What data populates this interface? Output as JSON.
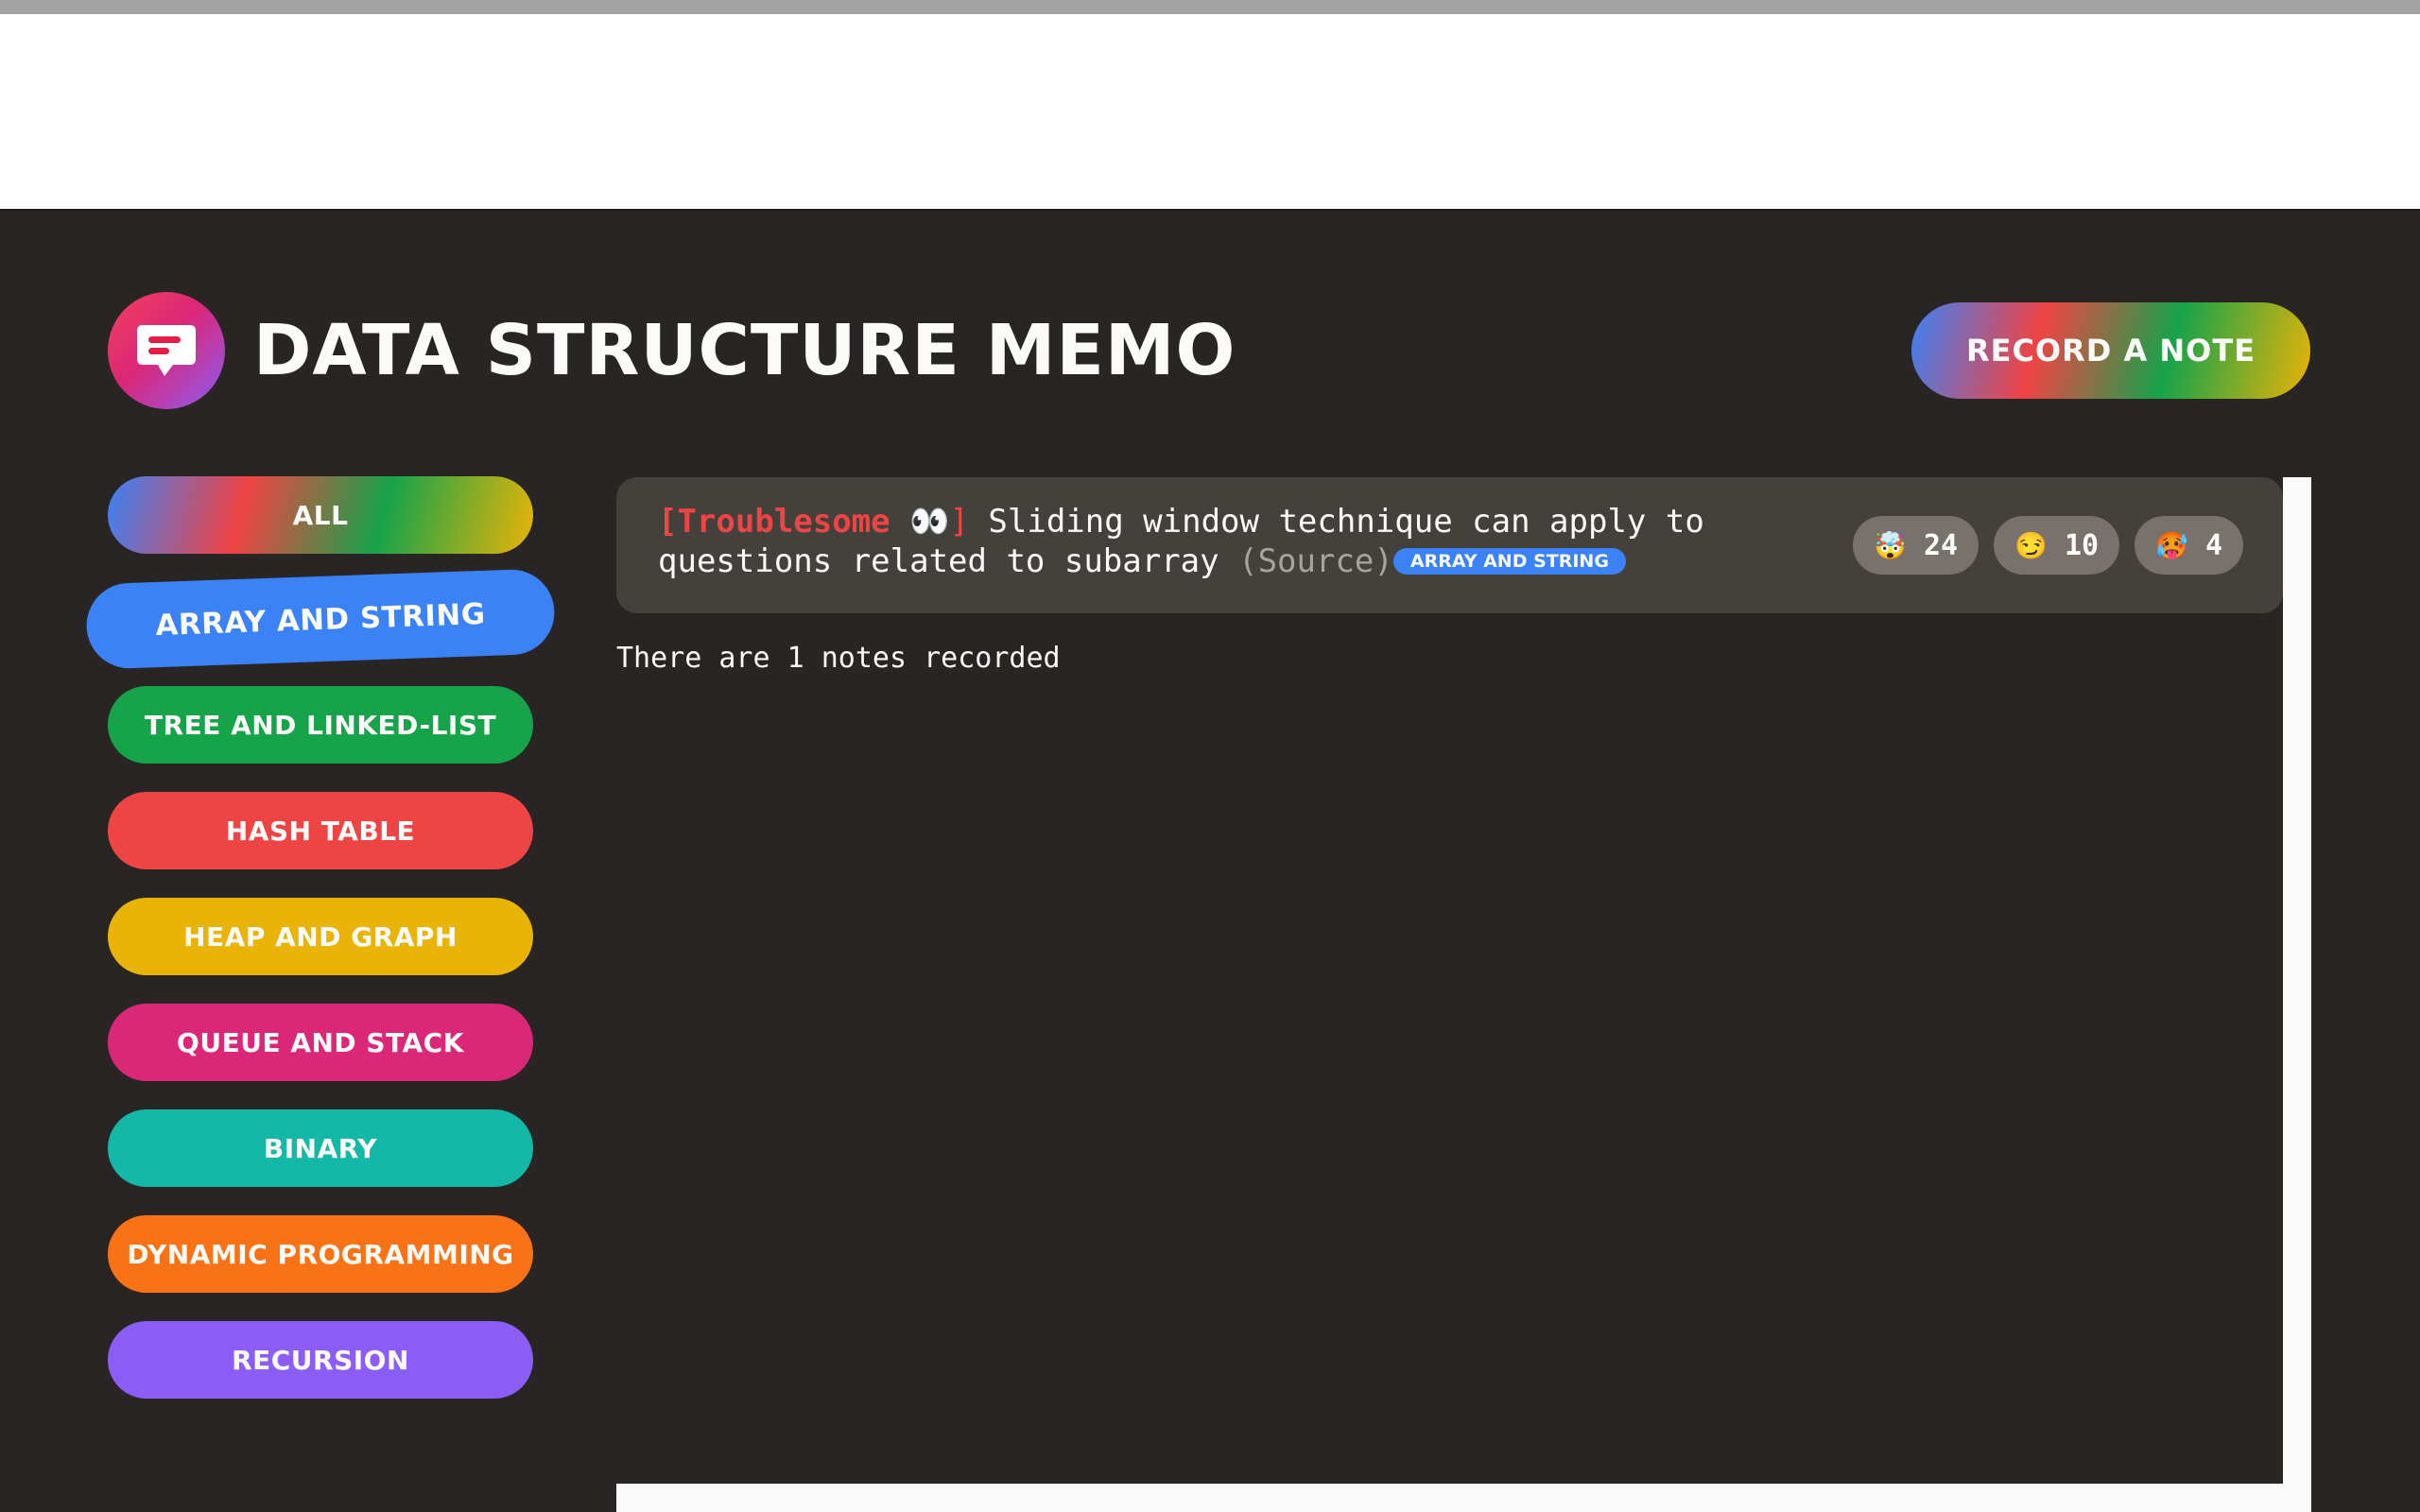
{
  "header": {
    "title": "DATA STRUCTURE MEMO",
    "record_button": "RECORD A NOTE",
    "logo_icon": "chat-bubble-icon"
  },
  "sidebar": {
    "categories": [
      {
        "label": "ALL",
        "color": "gradient"
      },
      {
        "label": "ARRAY AND STRING",
        "color": "#3b82f6",
        "selected": true
      },
      {
        "label": "TREE AND LINKED-LIST",
        "color": "#16a34a"
      },
      {
        "label": "HASH TABLE",
        "color": "#ef4444"
      },
      {
        "label": "HEAP AND GRAPH",
        "color": "#eab308"
      },
      {
        "label": "QUEUE AND STACK",
        "color": "#db2777"
      },
      {
        "label": "BINARY",
        "color": "#14b8a6"
      },
      {
        "label": "DYNAMIC PROGRAMMING",
        "color": "#f97316"
      },
      {
        "label": "RECURSION",
        "color": "#8b5cf6"
      }
    ]
  },
  "notes": [
    {
      "tag": "[Troublesome",
      "tag_emoji": "👀]",
      "text": " Sliding window technique can apply to questions related to subarray ",
      "source": "(Source)",
      "category": "ARRAY AND STRING",
      "votes": [
        {
          "emoji": "🤯",
          "count": "24"
        },
        {
          "emoji": "😏",
          "count": "10"
        },
        {
          "emoji": "🥵",
          "count": "4"
        }
      ]
    }
  ],
  "status": {
    "notes_count": "There are 1 notes recorded"
  },
  "colors": {
    "background": "#292524",
    "card": "#44403c",
    "vote": "#78716c",
    "accent_red": "#ef4444"
  }
}
